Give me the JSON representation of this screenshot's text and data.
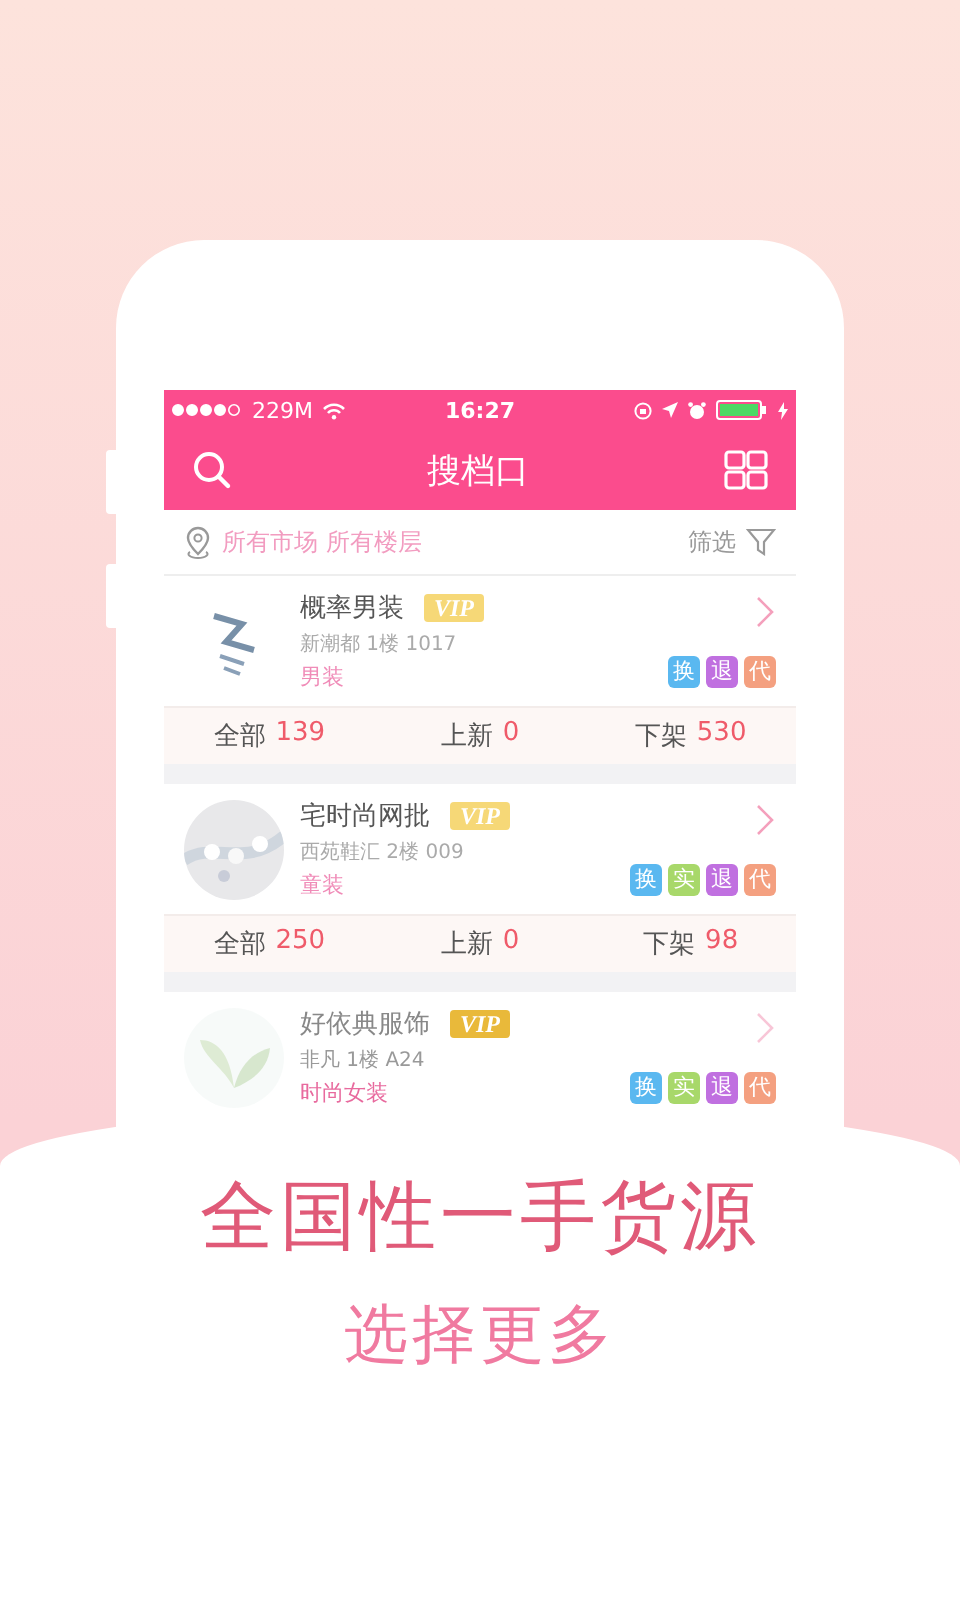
{
  "status_bar": {
    "carrier": "229M",
    "time": "16:27"
  },
  "nav": {
    "title": "搜档口"
  },
  "filter_bar": {
    "location": "所有市场 所有楼层",
    "filter": "筛选"
  },
  "shops": [
    {
      "name": "概率男装",
      "badge": "VIP",
      "address": "新潮都 1楼 1017",
      "category": "男装",
      "faded": false,
      "tags": [
        {
          "label": "换",
          "color": "#5ab8f0"
        },
        {
          "label": "退",
          "color": "#c070e0"
        },
        {
          "label": "代",
          "color": "#f4a080"
        }
      ],
      "stats": [
        {
          "label": "全部",
          "value": "139"
        },
        {
          "label": "上新",
          "value": "0"
        },
        {
          "label": "下架",
          "value": "530"
        }
      ]
    },
    {
      "name": "宅时尚网批",
      "badge": "VIP",
      "address": "西苑鞋汇 2楼 009",
      "category": "童装",
      "faded": false,
      "tags": [
        {
          "label": "换",
          "color": "#5ab8f0"
        },
        {
          "label": "实",
          "color": "#a8d86a"
        },
        {
          "label": "退",
          "color": "#c070e0"
        },
        {
          "label": "代",
          "color": "#f4a080"
        }
      ],
      "stats": [
        {
          "label": "全部",
          "value": "250"
        },
        {
          "label": "上新",
          "value": "0"
        },
        {
          "label": "下架",
          "value": "98"
        }
      ]
    },
    {
      "name": "好依典服饰",
      "badge": "VIP",
      "address": "非凡 1楼 A24",
      "category": "时尚女装",
      "faded": true,
      "tags": [
        {
          "label": "换",
          "color": "#5ab8f0"
        },
        {
          "label": "实",
          "color": "#a8d86a"
        },
        {
          "label": "退",
          "color": "#c070e0"
        },
        {
          "label": "代",
          "color": "#f4a080"
        }
      ]
    }
  ],
  "headline": "全国性一手货源",
  "subheadline": "选择更多"
}
